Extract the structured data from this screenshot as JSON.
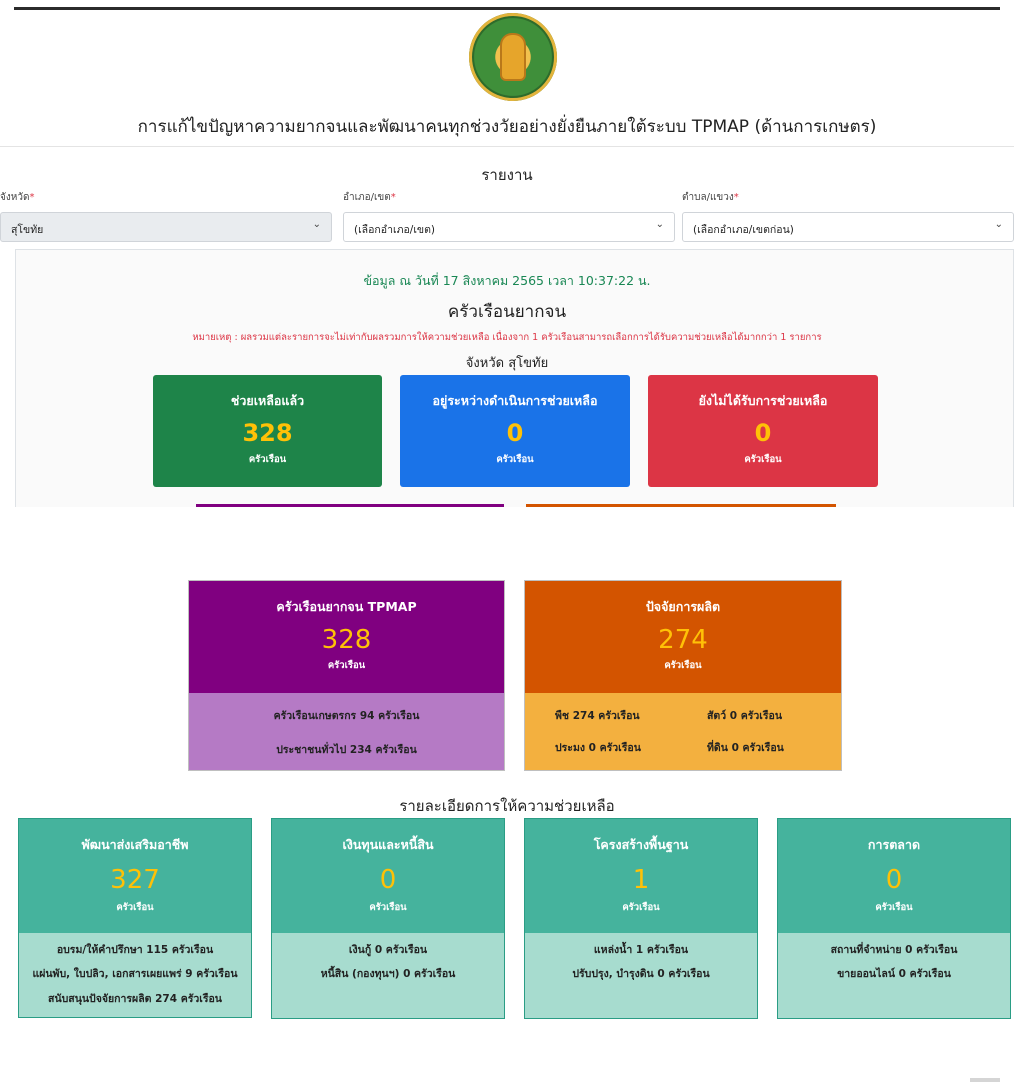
{
  "header": {
    "title": "การแก้ไขปัญหาความยากจนและพัฒนาคนทุกช่วงวัยอย่างยั่งยืนภายใต้ระบบ TPMAP (ด้านการเกษตร)"
  },
  "report": {
    "title": "รายงาน",
    "province": {
      "label": "จังหวัด",
      "value": "สุโขทัย"
    },
    "district": {
      "label": "อำเภอ/เขต",
      "value": "(เลือกอำเภอ/เขต)"
    },
    "subdistrict": {
      "label": "ตำบล/แขวง",
      "value": "(เลือกอำเภอ/เขตก่อน)"
    },
    "required_mark": "*"
  },
  "summary": {
    "as_of": "ข้อมูล ณ วันที่ 17 สิงหาคม 2565 เวลา 10:37:22 น.",
    "title": "ครัวเรือนยากจน",
    "note": "หมายเหตุ : ผลรวมแต่ละรายการจะไม่เท่ากับผลรวมการให้ความช่วยเหลือ เนื่องจาก 1 ครัวเรือนสามารถเลือกการได้รับความช่วยเหลือได้มากกว่า 1 รายการ",
    "province_line": "จังหวัด สุโขทัย",
    "stats": [
      {
        "label": "ช่วยเหลือแล้ว",
        "value": "328",
        "unit": "ครัวเรือน",
        "color": "#1e8449"
      },
      {
        "label": "อยู่ระหว่างดำเนินการช่วยเหลือ",
        "value": "0",
        "unit": "ครัวเรือน",
        "color": "#1a73e8"
      },
      {
        "label": "ยังไม่ได้รับการช่วยเหลือ",
        "value": "0",
        "unit": "ครัวเรือน",
        "color": "#dc3545"
      }
    ]
  },
  "tpmap": {
    "label": "ครัวเรือนยากจน TPMAP",
    "value": "328",
    "unit": "ครัวเรือน",
    "color": "#800080",
    "light_color": "#b57ac5",
    "lines": [
      "ครัวเรือนเกษตรกร 94 ครัวเรือน",
      "ประชาชนทั่วไป 234 ครัวเรือน"
    ]
  },
  "production": {
    "label": "ปัจจัยการผลิต",
    "value": "274",
    "unit": "ครัวเรือน",
    "color": "#d35400",
    "light_color": "#f3b03f",
    "items": [
      "พืช 274 ครัวเรือน",
      "สัตว์ 0 ครัวเรือน",
      "ประมง 0 ครัวเรือน",
      "ที่ดิน 0 ครัวเรือน"
    ]
  },
  "details": {
    "title": "รายละเอียดการให้ความช่วยเหลือ",
    "cards": [
      {
        "label": "พัฒนาส่งเสริมอาชีพ",
        "value": "327",
        "unit": "ครัวเรือน",
        "lines": [
          "อบรม/ให้คำปรึกษา 115 ครัวเรือน",
          "แผ่นพับ, ใบปลิว, เอกสารเผยแพร่ 9 ครัวเรือน",
          "สนับสนุนปัจจัยการผลิต 274 ครัวเรือน"
        ]
      },
      {
        "label": "เงินทุนและหนี้สิน",
        "value": "0",
        "unit": "ครัวเรือน",
        "lines": [
          "เงินกู้ 0 ครัวเรือน",
          "หนี้สิน (กองทุนฯ) 0 ครัวเรือน"
        ]
      },
      {
        "label": "โครงสร้างพื้นฐาน",
        "value": "1",
        "unit": "ครัวเรือน",
        "lines": [
          "แหล่งน้ำ 1 ครัวเรือน",
          "ปรับปรุง, บำรุงดิน 0 ครัวเรือน"
        ]
      },
      {
        "label": "การตลาด",
        "value": "0",
        "unit": "ครัวเรือน",
        "lines": [
          "สถานที่จำหน่าย 0 ครัวเรือน",
          "ขายออนไลน์ 0 ครัวเรือน"
        ]
      }
    ]
  }
}
